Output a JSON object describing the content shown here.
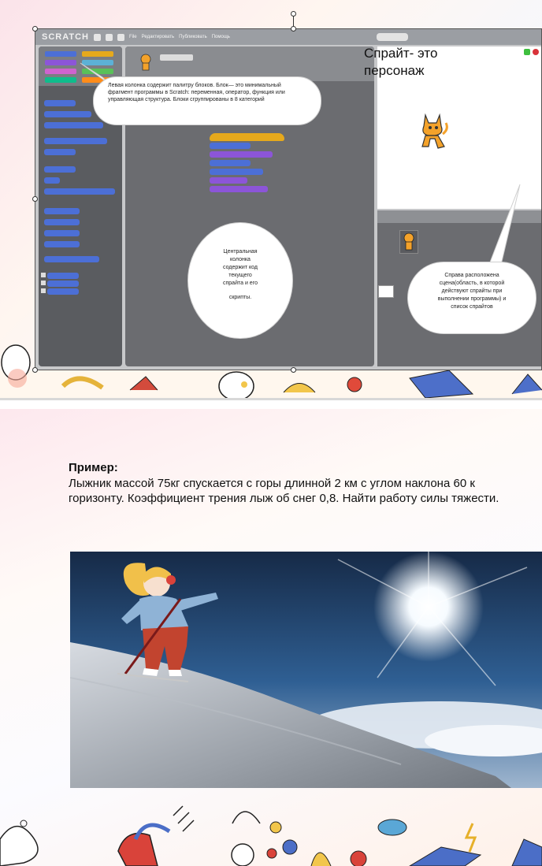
{
  "slide1": {
    "scratch": {
      "logo_text": "SCRATCH",
      "menu_items": [
        "File",
        "Редактировать",
        "Публиковать",
        "Помощь"
      ]
    },
    "callouts": {
      "palette": "Левая колонка содержит палитру блоков. Блок— это минимальный фрагмент программы в Scratch: переменная, оператор, функция или управляющая структура. Блоки сгруппированы в 8 категорий",
      "scripts": [
        "Центральная",
        "колонка",
        "содержит код",
        "текущего",
        "спрайта и его",
        "скрипты."
      ],
      "stage": [
        "Справа расположена",
        "сцена(область, в которой",
        "действуют спрайты при",
        "выполнении программы) и",
        "список спрайтов"
      ]
    },
    "stage_title": [
      "Спрайт- это",
      "персонаж"
    ]
  },
  "slide2": {
    "example_title": "Пример:",
    "example_text": "Лыжник массой 75кг спускается с горы  длинной 2 км с углом наклона 60 к горизонту. Коэффициент трения лыж об снег 0,8. Найти работу силы тяжести."
  },
  "colors": {
    "scratch_gray": "#6b6c70",
    "motion_blue": "#4c6fd6",
    "events_yellow": "#e6a91c",
    "looks_purple": "#8c55d8"
  }
}
